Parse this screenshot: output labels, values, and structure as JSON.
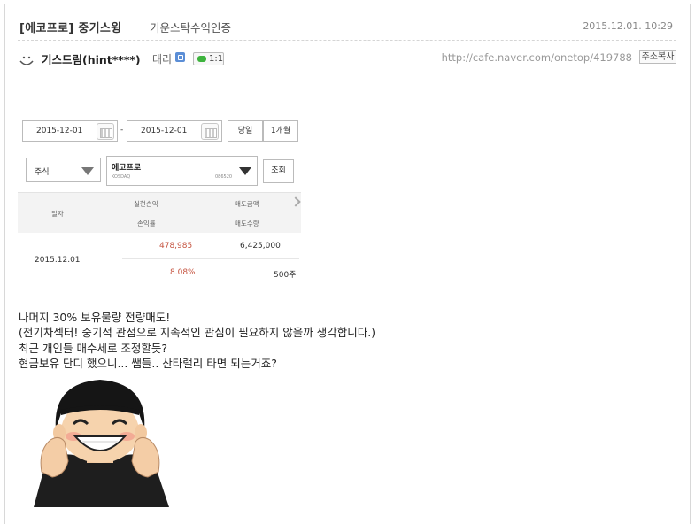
{
  "post": {
    "title": "[에코프로] 중기스윙",
    "menu": "기운스탁수익인증",
    "date": "2015.12.01. 10:29"
  },
  "author": {
    "name": "기스드림(hint****)",
    "rank": "대리",
    "chat_label": "1:1",
    "cafe_url": "http://cafe.naver.com/onetop/419788",
    "copy_label": "주소복사"
  },
  "screenshot": {
    "start_date": "2015-12-01",
    "end_date": "2015-12-01",
    "date_separator": "-",
    "btn_today": "당일",
    "btn_month": "1개월",
    "type_select": "주식",
    "stock_name": "에코프로",
    "stock_market": "KOSDAQ",
    "stock_code": "086520",
    "btn_query": "조회",
    "headers": {
      "date": "일자",
      "realized_pnl": "실현손익",
      "sell_amount": "매도금액",
      "return_rate": "손익률",
      "sell_qty": "매도수량"
    },
    "row": {
      "date": "2015.12.01",
      "realized_pnl": "478,985",
      "sell_amount": "6,425,000",
      "return_rate": "8.08%",
      "sell_qty": "500주"
    }
  },
  "body": {
    "lines": [
      "나머지 30% 보유물량 전량매도!",
      "(전기차섹터! 중기적 관점으로 지속적인 관심이 필요하지 않을까 생각합니다.)",
      "최근 개인들 매수세로 조정할듯?",
      "현금보유 단디 했으니... 쌤들.. 산타랠리 타면 되는거죠?"
    ]
  },
  "colors": {
    "profit_red": "#c5533f",
    "chat_green": "#3db33d",
    "rank_blue": "#5b8ed6"
  }
}
